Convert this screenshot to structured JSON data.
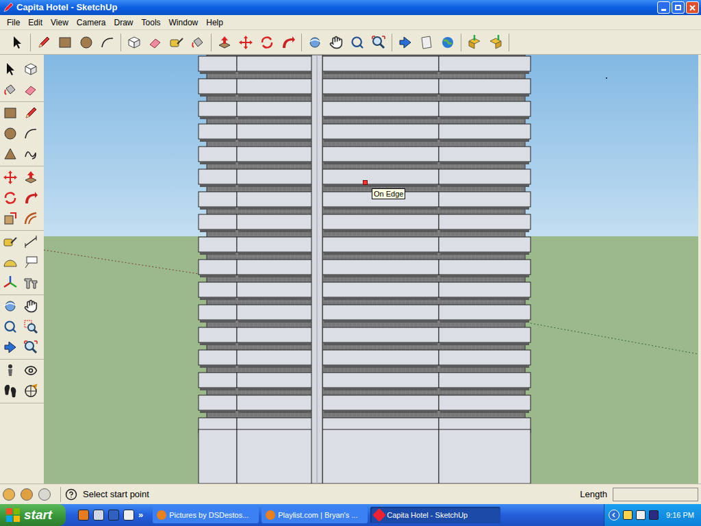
{
  "window": {
    "title": "Capita Hotel - SketchUp"
  },
  "menu": [
    "File",
    "Edit",
    "View",
    "Camera",
    "Draw",
    "Tools",
    "Window",
    "Help"
  ],
  "canvas": {
    "tooltip": "On Edge"
  },
  "status_bar": {
    "hint": "Select start point",
    "measurement_label": "Length",
    "measurement_value": ""
  },
  "taskbar": {
    "start": "start",
    "quick_launch_more": "»",
    "tasks": [
      {
        "label": "Pictures by DSDestos...",
        "selected": false
      },
      {
        "label": "Playlist.com | Bryan's ...",
        "selected": false
      },
      {
        "label": "Capita Hotel - SketchUp",
        "selected": true
      }
    ],
    "clock": "9:16 PM"
  }
}
